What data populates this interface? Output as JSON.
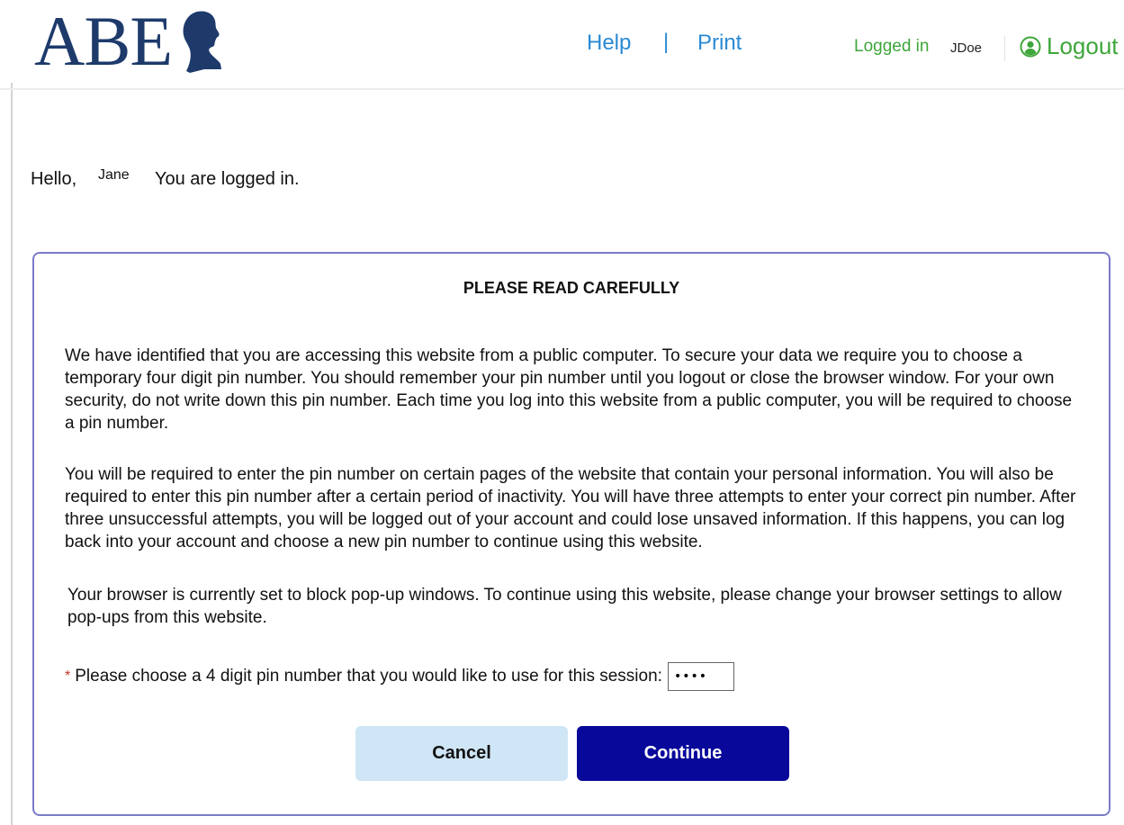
{
  "header": {
    "logo_text": "ABE",
    "nav": {
      "help": "Help",
      "separator": "|",
      "print": "Print"
    },
    "session": {
      "logged_in_label": "Logged in",
      "username": "JDoe",
      "logout_label": "Logout"
    }
  },
  "greeting": {
    "hello": "Hello,",
    "name": "Jane",
    "status": "You are logged in."
  },
  "dialog": {
    "title": "PLEASE READ CAREFULLY",
    "paragraphs": [
      "We have identified that you are accessing this website from a public computer. To secure your data we require you to choose a temporary four digit pin number. You should remember your pin number until you logout or close the browser window. For your own security, do not write down this pin number. Each time you log into this website from a public computer, you will be required to choose a pin number.",
      "You will be required to enter the pin number on certain pages of the website that contain your personal information. You will also be required to enter this pin number after a certain period of inactivity. You will have three attempts to enter your correct pin number. After three unsuccessful attempts, you will be logged out of your account and could lose unsaved information. If this happens, you can log back into your account and choose a new pin number to continue using this website.",
      "Your browser is currently set to block pop-up windows. To continue using this website, please change your browser settings to allow pop-ups from this website."
    ],
    "pin": {
      "required_marker": "*",
      "label": "Please choose a 4 digit pin number that you would like to use for this session:",
      "value": "••••"
    },
    "buttons": {
      "cancel": "Cancel",
      "continue": "Continue"
    }
  },
  "colors": {
    "logo": "#1d3a6b",
    "nav_link": "#2a8ad3",
    "session_green": "#3ea63a",
    "dialog_border": "#7a7bc8",
    "cancel_bg": "#cfe6f6",
    "continue_bg": "#08089a"
  },
  "icons": {
    "logo_silhouette": "portrait-silhouette-icon",
    "logout": "user-circle-icon"
  }
}
